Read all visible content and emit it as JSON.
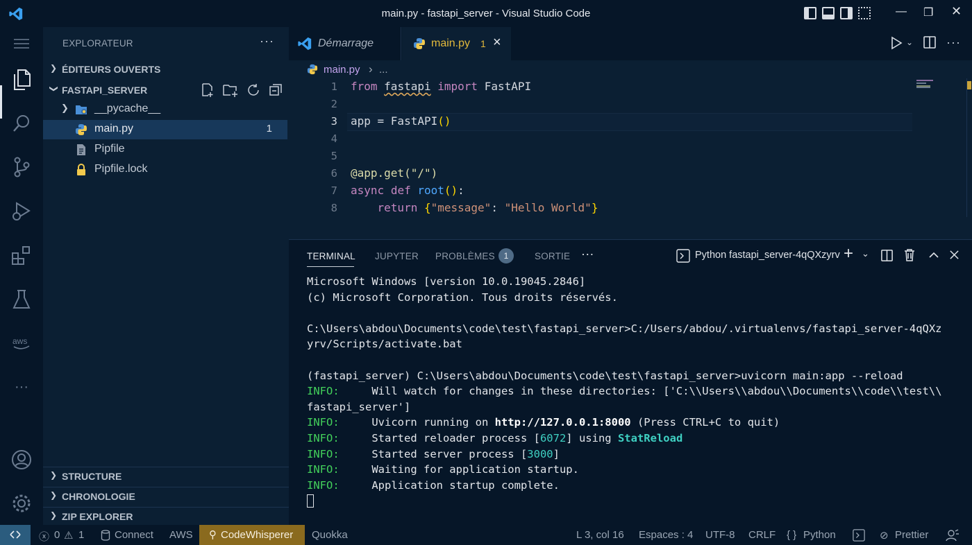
{
  "window": {
    "title": "main.py - fastapi_server - Visual Studio Code"
  },
  "sidebar": {
    "title": "EXPLORATEUR",
    "more": "···",
    "open_editors": "ÉDITEURS OUVERTS",
    "project": "FASTAPI_SERVER",
    "files": [
      {
        "name": "__pycache__",
        "icon": "folder-icon"
      },
      {
        "name": "main.py",
        "icon": "python-icon",
        "badge": "1"
      },
      {
        "name": "Pipfile",
        "icon": "file-icon"
      },
      {
        "name": "Pipfile.lock",
        "icon": "lock-icon"
      }
    ],
    "bottom_sections": [
      "STRUCTURE",
      "CHRONOLOGIE",
      "ZIP EXPLORER"
    ]
  },
  "tabs": [
    {
      "label": "Démarrage"
    },
    {
      "label": "main.py",
      "badge": "1",
      "close": "×"
    }
  ],
  "breadcrumb": {
    "file": "main.py",
    "sep": "›",
    "rest": "..."
  },
  "editor": {
    "line_numbers": [
      "1",
      "2",
      "3",
      "4",
      "5",
      "6",
      "7",
      "8"
    ],
    "current_line": "3",
    "code": {
      "l1_from": "from",
      "l1_mod": "fastapi",
      "l1_import": "import",
      "l1_cls": "FastAPI",
      "l3_var": "app = FastAPI",
      "l3_parens": "()",
      "l6_deco": "@app.get(\"/\")",
      "l7_async": "async",
      "l7_def": "def",
      "l7_fn": "root",
      "l7_parens": "()",
      "l7_colon": ":",
      "l8_return": "return",
      "l8_open": "{",
      "l8_key": "\"message\"",
      "l8_colon": ": ",
      "l8_val": "\"Hello World\"",
      "l8_close": "}"
    }
  },
  "panel": {
    "tabs": [
      "TERMINAL",
      "JUPYTER",
      "PROBLÈMES",
      "SORTIE"
    ],
    "problems_count": "1",
    "more": "···",
    "terminal_name": "Python fastapi_server-4qQXzyrv",
    "terminal": {
      "l1": "Microsoft Windows [version 10.0.19045.2846]",
      "l2": "(c) Microsoft Corporation. Tous droits réservés.",
      "l4": "C:\\Users\\abdou\\Documents\\code\\test\\fastapi_server>C:/Users/abdou/.virtualenvs/fastapi_server-4qQXz",
      "l5": "yrv/Scripts/activate.bat",
      "l7": "(fastapi_server) C:\\Users\\abdou\\Documents\\code\\test\\fastapi_server>uvicorn main:app --reload",
      "info": "INFO:",
      "l8": "     Will watch for changes in these directories: ['C:\\\\Users\\\\abdou\\\\Documents\\\\code\\\\test\\\\",
      "l9": "fastapi_server']",
      "l10a": "     Uvicorn running on ",
      "l10b": "http://127.0.0.1:8000",
      "l10c": " (Press CTRL+C to quit)",
      "l11a": "     Started reloader process [",
      "l11b": "6072",
      "l11c": "] using ",
      "l11d": "StatReload",
      "l12a": "     Started server process [",
      "l12b": "3000",
      "l12c": "]",
      "l13": "     Waiting for application startup.",
      "l14": "     Application startup complete."
    }
  },
  "statusbar": {
    "errors": "0",
    "warnings": "1",
    "connect": "Connect",
    "aws": "AWS",
    "codewhisperer": "CodeWhisperer",
    "quokka": "Quokka",
    "position": "L 3, col 16",
    "spaces": "Espaces : 4",
    "encoding": "UTF-8",
    "eol": "CRLF",
    "language": "Python",
    "prettier": "Prettier"
  },
  "colors": {
    "background": "#0b1f33",
    "chrome": "#061628",
    "accent_codewhisperer": "#8a6a1e",
    "info_green": "#43d15b"
  }
}
